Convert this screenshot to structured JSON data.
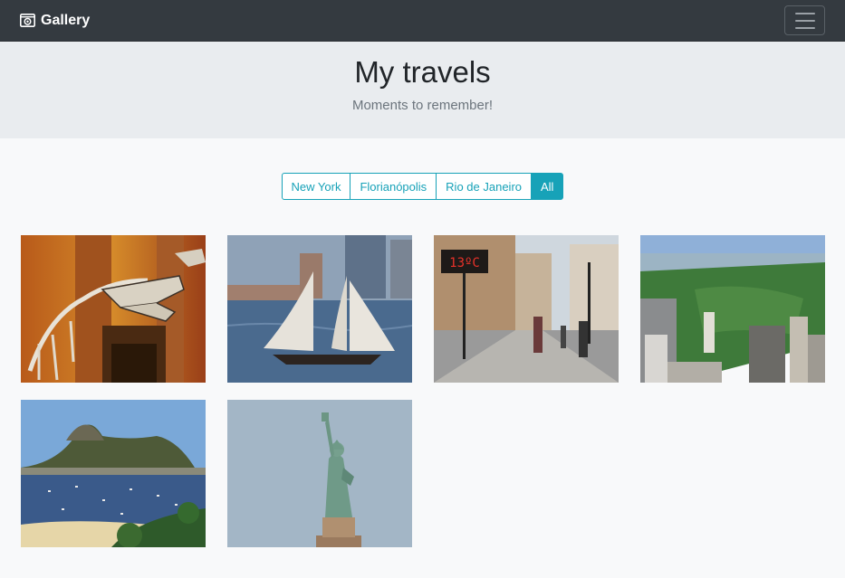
{
  "navbar": {
    "brand_label": "Gallery",
    "brand_icon": "camera-icon",
    "menu_icon": "hamburger-icon"
  },
  "header": {
    "title": "My travels",
    "subtitle": "Moments to remember!"
  },
  "filters": [
    {
      "label": "New York",
      "active": false
    },
    {
      "label": "Florianópolis",
      "active": false
    },
    {
      "label": "Rio de Janeiro",
      "active": false
    },
    {
      "label": "All",
      "active": true
    }
  ],
  "photos": [
    {
      "subject": "dinosaur-skeleton",
      "sign_text": ""
    },
    {
      "subject": "schooner-sailboat",
      "sign_text": ""
    },
    {
      "subject": "street-thermometer",
      "sign_text": "13ºC"
    },
    {
      "subject": "central-park-aerial",
      "sign_text": ""
    },
    {
      "subject": "sugarloaf-mountain",
      "sign_text": ""
    },
    {
      "subject": "statue-of-liberty",
      "sign_text": ""
    }
  ],
  "colors": {
    "navbar": "#343a40",
    "jumbotron": "#e9ecef",
    "accent": "#17a2b8",
    "page": "#f8f9fa"
  }
}
